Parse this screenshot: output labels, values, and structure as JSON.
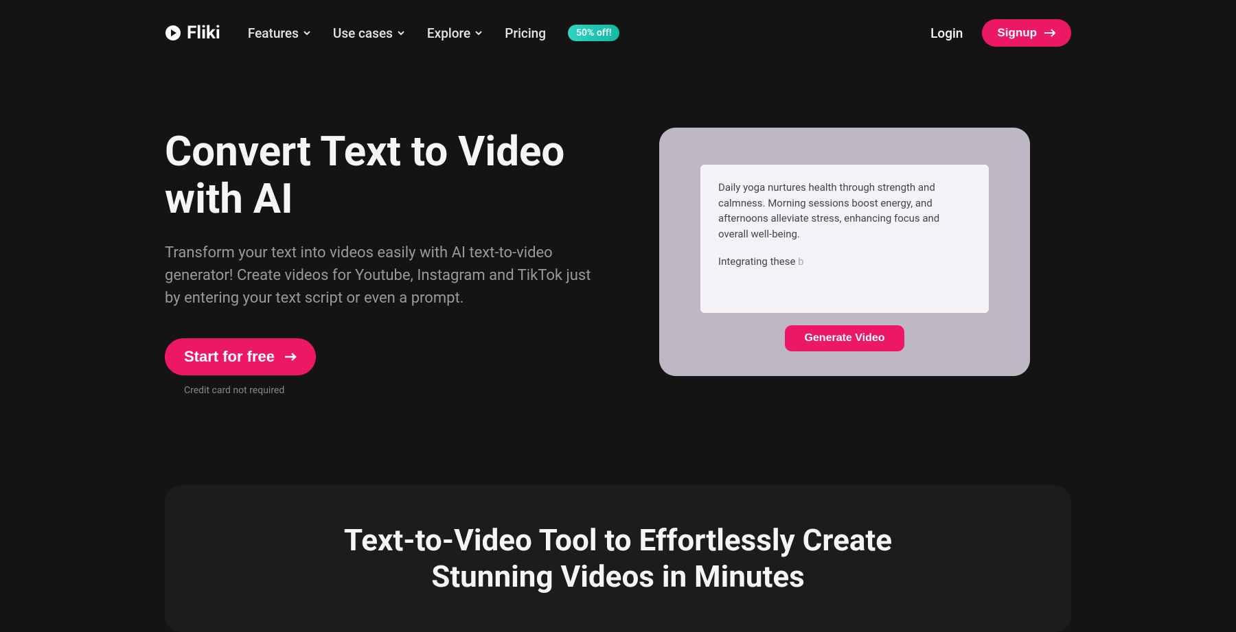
{
  "brand": "Fliki",
  "nav": {
    "items": [
      "Features",
      "Use cases",
      "Explore",
      "Pricing"
    ],
    "badge": "50% off!",
    "login": "Login",
    "signup": "Signup"
  },
  "hero": {
    "title": "Convert Text to Video with AI",
    "description": "Transform your text into videos easily with AI text-to-video generator! Create videos for Youtube, Instagram and TikTok just by entering your text script or even a prompt.",
    "cta": "Start for free",
    "subtext": "Credit card not required"
  },
  "demo": {
    "paragraph1": "Daily yoga nurtures health through strength and calmness. Morning sessions boost energy, and afternoons alleviate stress, enhancing focus and overall well-being.",
    "paragraph2": "Integrating these ",
    "typing_tail": "b",
    "button": "Generate Video"
  },
  "section2": {
    "title_line1": "Text-to-Video Tool to Effortlessly Create",
    "title_line2": "Stunning Videos in Minutes"
  }
}
